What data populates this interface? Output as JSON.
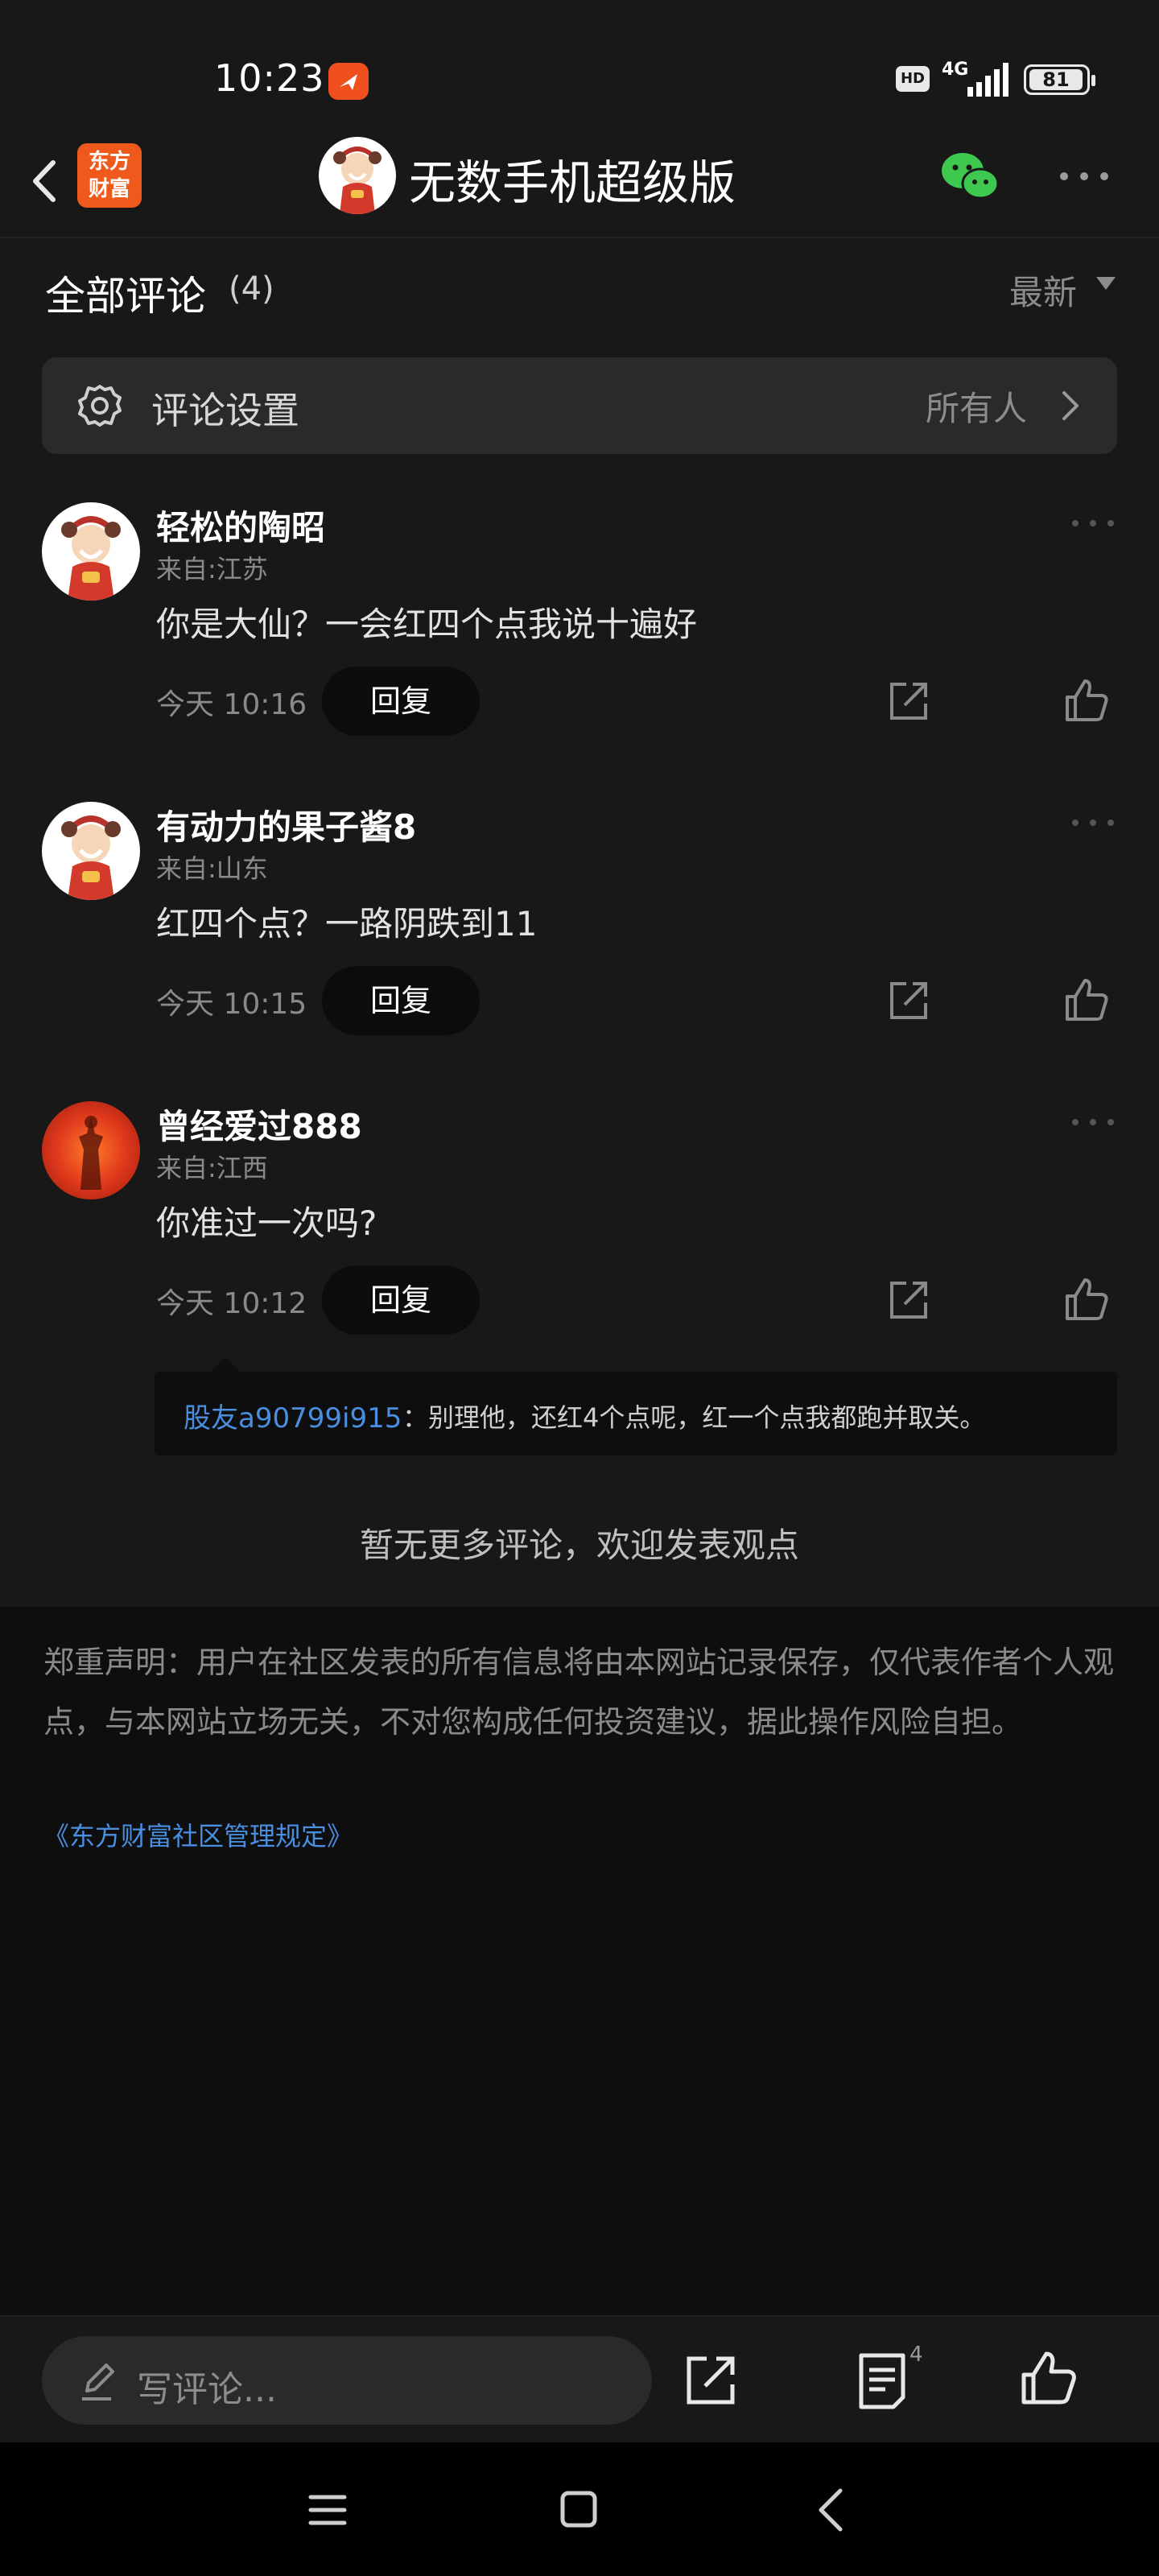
{
  "status_bar": {
    "time": "10:23",
    "network": "4G",
    "hd": "HD",
    "battery": "81"
  },
  "nav": {
    "brand_logo": "东方\n财富",
    "title": "无数手机超级版"
  },
  "comments_header": {
    "title": "全部评论",
    "count": "(4)",
    "sort": "最新"
  },
  "settings": {
    "label": "评论设置",
    "value": "所有人"
  },
  "comments": [
    {
      "name": "轻松的陶昭",
      "location": "来自:江苏",
      "text": "你是大仙？一会红四个点我说十遍好",
      "time": "今天 10:16",
      "reply": "回复"
    },
    {
      "name": "有动力的果子酱8",
      "location": "来自:山东",
      "text": "红四个点？一路阴跌到11",
      "time": "今天 10:15",
      "reply": "回复"
    },
    {
      "name": "曾经爱过888",
      "location": "来自:江西",
      "text": "你准过一次吗?",
      "time": "今天 10:12",
      "reply": "回复"
    }
  ],
  "sub_reply": {
    "user": "股友a90799i915",
    "text": "：别理他，还红4个点呢，红一个点我都跑并取关。"
  },
  "no_more": "暂无更多评论，欢迎发表观点",
  "disclaimer": "郑重声明：用户在社区发表的所有信息将由本网站记录保存，仅代表作者个人观点，与本网站立场无关，不对您构成任何投资建议，据此操作风险自担。",
  "rules_link": "《东方财富社区管理规定》",
  "bottom_bar": {
    "input_placeholder": "写评论...",
    "comment_badge": "4"
  },
  "colors": {
    "background": "#181818",
    "accent_link": "#4a8ee0",
    "brand": "#ef5a1c",
    "wechat": "#3ec84f"
  }
}
